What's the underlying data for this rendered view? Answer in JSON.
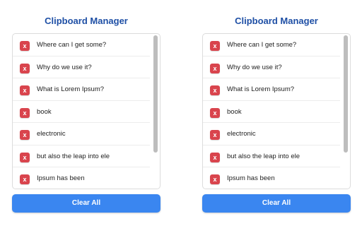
{
  "app": {
    "title": "Clipboard Manager",
    "clear_all_label": "Clear All",
    "delete_icon_glyph": "x",
    "accent_color": "#3a86f0",
    "delete_color": "#d9444d",
    "title_color": "#1e4fa5"
  },
  "panels": [
    {
      "items": [
        {
          "text": "Where can I get some?"
        },
        {
          "text": "Why do we use it?"
        },
        {
          "text": "What is Lorem Ipsum?"
        },
        {
          "text": "book"
        },
        {
          "text": "electronic"
        },
        {
          "text": "but also the leap into ele"
        },
        {
          "text": "Ipsum has been"
        }
      ]
    },
    {
      "items": [
        {
          "text": "Where can I get some?"
        },
        {
          "text": "Why do we use it?"
        },
        {
          "text": "What is Lorem Ipsum?"
        },
        {
          "text": "book"
        },
        {
          "text": "electronic"
        },
        {
          "text": "but also the leap into ele"
        },
        {
          "text": "Ipsum has been"
        }
      ]
    }
  ]
}
